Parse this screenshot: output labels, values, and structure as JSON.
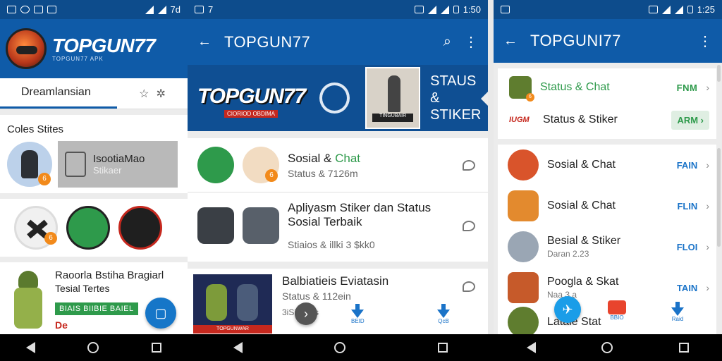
{
  "screen1": {
    "status": {
      "time": "7d"
    },
    "logo": {
      "text": "TOPGUN77",
      "sub": "TOPGUN77 APK"
    },
    "tabs": {
      "active_label": "Dreamlansian"
    },
    "section1": {
      "title": "Coles Stites",
      "card_title": "IsootiaMao",
      "card_sub": "Stikaer"
    },
    "card3": {
      "line1": "Raoorla Bstiha Bragiarl",
      "line2": "Tesial Tertes",
      "green_btn": "BIAIS BIIBIE BAIEL",
      "red_text": "De"
    }
  },
  "screen2": {
    "status": {
      "left": "7",
      "time": "1:50"
    },
    "title": "TOPGUN77",
    "banner": {
      "logo_text": "TOPGUN77",
      "logo_sub": "CIORIOD OBDIMA",
      "img_label": "TINGUBAIR",
      "title_line1": "STAUS &",
      "title_line2": "STIKER"
    },
    "items": [
      {
        "title_a": "Sosial & ",
        "title_b": "Chat",
        "sub": "Status & 7126m"
      },
      {
        "title": "Apliyasm Stiker dan Status Sosial Terbaik",
        "sub": "Stiaios & illki 3 $kk0"
      }
    ],
    "card2": {
      "title": "Balbiatieis Eviatasin",
      "sub": "Status & 112ein",
      "extra": "3iSi tkoos"
    },
    "thumb_label": "TOPGUNWAR",
    "bottom": {
      "btn1": "BEID",
      "btn2": "QcB"
    }
  },
  "screen3": {
    "status": {
      "time": "1:25"
    },
    "title": "TOPGUNI77",
    "top_items": [
      {
        "label": "Status & Chat",
        "action": "FNM"
      },
      {
        "label": "Status & Stiker",
        "action": "ARM",
        "logo": "IUGM"
      }
    ],
    "items": [
      {
        "label": "Sosial & Chat",
        "sub": "",
        "action": "FAIN"
      },
      {
        "label": "Sosial & Chat",
        "sub": "",
        "action": "FLIN"
      },
      {
        "label": "Besial & Stiker",
        "sub": "Daran 2.23",
        "action": "FLOI"
      },
      {
        "label": "Poogla & Skat",
        "sub": "Naa 3.a",
        "action": "TAIN"
      },
      {
        "label": "Latale Stat",
        "sub": "",
        "action": ""
      }
    ],
    "bottom": {
      "btn1": "BBIO",
      "btn2": "Raid"
    }
  },
  "colors": {
    "primary": "#0f5ba8",
    "statusbar": "#0d4c8c",
    "accent_green": "#2e9a4b",
    "accent_blue": "#1a73c8",
    "alert_red": "#c6281e"
  },
  "icons": [
    "back-arrow-icon",
    "search-icon",
    "overflow-menu-icon",
    "chat-bubble-icon",
    "download-icon",
    "chevron-right-icon",
    "nav-back-icon",
    "nav-home-icon",
    "nav-recents-icon"
  ]
}
